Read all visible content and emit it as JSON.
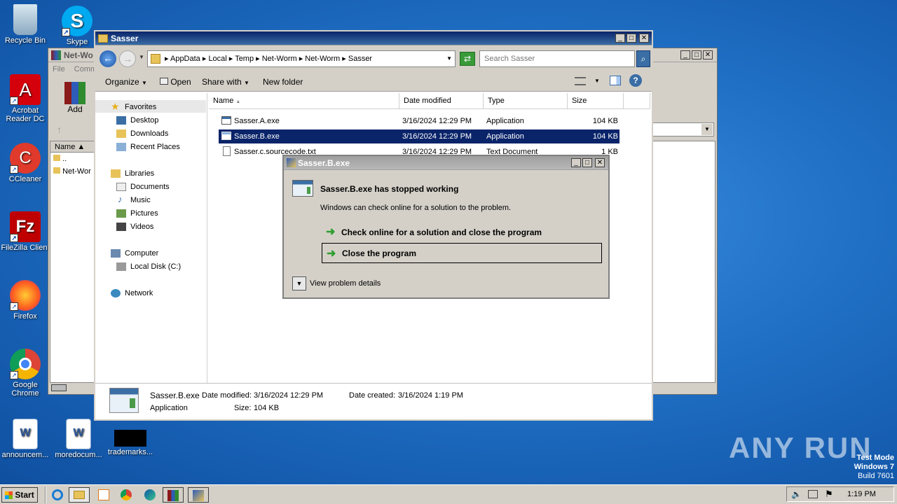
{
  "desktop_icons": [
    {
      "label": "Recycle Bin"
    },
    {
      "label": "Skype"
    },
    {
      "label": "Acrobat Reader DC"
    },
    {
      "label": "CCleaner"
    },
    {
      "label": "FileZilla Client"
    },
    {
      "label": "Firefox"
    },
    {
      "label": "Google Chrome"
    },
    {
      "label": "announcem..."
    },
    {
      "label": "moredocum..."
    },
    {
      "label": "trademarks..."
    }
  ],
  "back_window": {
    "title": "Net-Wo",
    "menu": [
      "File",
      "Comm"
    ],
    "add_label": "Add",
    "col_name": "Name",
    "rows": [
      "..",
      "Net-Wor"
    ]
  },
  "explorer": {
    "title": "Sasser",
    "breadcrumb": [
      "AppData",
      "Local",
      "Temp",
      "Net-Worm",
      "Net-Worm",
      "Sasser"
    ],
    "search_placeholder": "Search Sasser",
    "toolbar": {
      "organize": "Organize",
      "open": "Open",
      "share": "Share with",
      "new_folder": "New folder"
    },
    "nav": {
      "favorites": "Favorites",
      "desktop": "Desktop",
      "downloads": "Downloads",
      "recent": "Recent Places",
      "libraries": "Libraries",
      "documents": "Documents",
      "music": "Music",
      "pictures": "Pictures",
      "videos": "Videos",
      "computer": "Computer",
      "local_disk": "Local Disk (C:)",
      "network": "Network"
    },
    "columns": {
      "name": "Name",
      "date": "Date modified",
      "type": "Type",
      "size": "Size"
    },
    "files": [
      {
        "name": "Sasser.A.exe",
        "date": "3/16/2024 12:29 PM",
        "type": "Application",
        "size": "104 KB"
      },
      {
        "name": "Sasser.B.exe",
        "date": "3/16/2024 12:29 PM",
        "type": "Application",
        "size": "104 KB"
      },
      {
        "name": "Sasser.c.sourcecode.txt",
        "date": "3/16/2024 12:29 PM",
        "type": "Text Document",
        "size": "1 KB"
      }
    ],
    "details": {
      "filename": "Sasser.B.exe",
      "modified_label": "Date modified:",
      "modified": "3/16/2024 12:29 PM",
      "created_label": "Date created:",
      "created": "3/16/2024 1:19 PM",
      "type": "Application",
      "size_label": "Size:",
      "size": "104 KB"
    }
  },
  "dialog": {
    "title": "Sasser.B.exe",
    "heading": "Sasser.B.exe has stopped working",
    "message": "Windows can check online for a solution to the problem.",
    "option1": "Check online for a solution and close the program",
    "option2": "Close the program",
    "details": "View problem details"
  },
  "taskbar": {
    "start": "Start",
    "time": "1:19 PM"
  },
  "watermark": {
    "brand": "ANY RUN",
    "line1": "Test Mode",
    "line2": "Windows 7",
    "line3": "Build 7601"
  },
  "colors": {
    "selection": "#0a246a",
    "desktop": "#1f6fc4",
    "arrow_green": "#2e9e2e"
  }
}
